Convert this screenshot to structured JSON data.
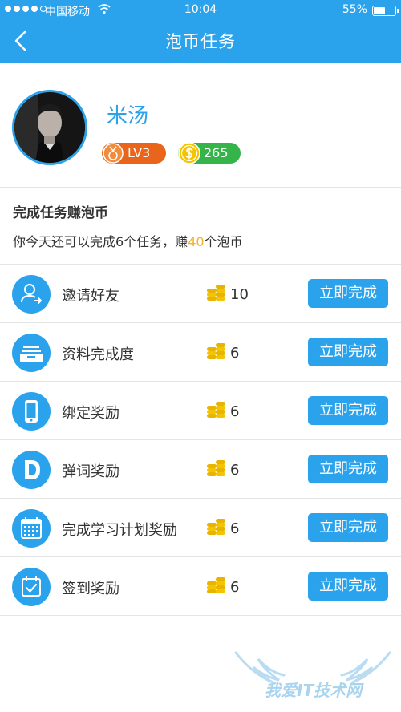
{
  "status_bar": {
    "carrier": "中国移动",
    "time": "10:04",
    "battery": "55%",
    "battery_level": 0.55
  },
  "nav": {
    "title": "泡币任务",
    "back_icon": "chevron-left-icon"
  },
  "profile": {
    "username": "米汤",
    "level": "LV3",
    "coins": "265",
    "level_icon": "medal-icon",
    "coin_icon": "dollar-coin-icon"
  },
  "intro": {
    "title": "完成任务赚泡币",
    "desc_before": "你今天还可以完成6个任务，赚",
    "desc_highlight": "40",
    "desc_after": "个泡币"
  },
  "tasks": [
    {
      "name": "邀请好友",
      "reward": "10",
      "button": "立即完成",
      "icon": "invite-friend-icon"
    },
    {
      "name": "资料完成度",
      "reward": "6",
      "button": "立即完成",
      "icon": "profile-folder-icon"
    },
    {
      "name": "绑定奖励",
      "reward": "6",
      "button": "立即完成",
      "icon": "phone-icon"
    },
    {
      "name": "弹词奖励",
      "reward": "6",
      "button": "立即完成",
      "icon": "letter-d-icon"
    },
    {
      "name": "完成学习计划奖励",
      "reward": "6",
      "button": "立即完成",
      "icon": "calendar-grid-icon"
    },
    {
      "name": "签到奖励",
      "reward": "6",
      "button": "立即完成",
      "icon": "calendar-check-icon"
    }
  ],
  "watermark": {
    "text": "我爱IT技术网"
  },
  "colors": {
    "primary": "#2aa3ec",
    "level_badge": "#e8651b",
    "coin_badge": "#35b44a",
    "highlight": "#f0b42a"
  }
}
